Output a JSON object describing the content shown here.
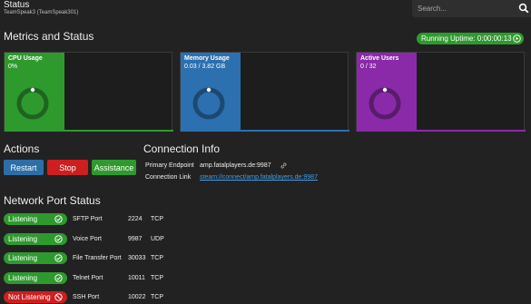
{
  "header": {
    "title": "Status",
    "subtitle": "TeamSpeak3 (TeamSpeak301)",
    "search_placeholder": "Search...",
    "search_icon": "search-icon"
  },
  "metrics": {
    "title": "Metrics and Status",
    "uptime_label": "Running Uptime: 0:00:00:13",
    "cards": [
      {
        "label": "CPU Usage",
        "value": "0%",
        "color": "#2e9a2e",
        "fraction": 0
      },
      {
        "label": "Memory Usage",
        "value": "0.03 / 3.82 GB",
        "color": "#2c70b0",
        "fraction": 0.008
      },
      {
        "label": "Active Users",
        "value": "0 / 32",
        "color": "#8a2aa8",
        "fraction": 0
      }
    ]
  },
  "actions": {
    "title": "Actions",
    "restart": "Restart",
    "stop": "Stop",
    "assistance": "Assistance",
    "colors": {
      "restart": "#2c6ea8",
      "stop": "#cc1f1f",
      "assistance": "#2e9a2e"
    }
  },
  "connection": {
    "title": "Connection Info",
    "primary_label": "Primary Endpoint",
    "primary_value": "amp.fatalplayers.de:9987",
    "link_label": "Connection Link",
    "link_value": "steam://connect/amp.fatalplayers.de:9987"
  },
  "ports": {
    "title": "Network Port Status",
    "rows": [
      {
        "status": "Listening",
        "ok": true,
        "name": "SFTP Port",
        "port": "2224",
        "protocol": "TCP"
      },
      {
        "status": "Listening",
        "ok": true,
        "name": "Voice Port",
        "port": "9987",
        "protocol": "UDP"
      },
      {
        "status": "Listening",
        "ok": true,
        "name": "File Transfer Port",
        "port": "30033",
        "protocol": "TCP"
      },
      {
        "status": "Listening",
        "ok": true,
        "name": "Telnet Port",
        "port": "10011",
        "protocol": "TCP"
      },
      {
        "status": "Not Listening",
        "ok": false,
        "name": "SSH Port",
        "port": "10022",
        "protocol": "TCP"
      }
    ],
    "colors": {
      "ok": "#2e9a2e",
      "bad": "#cc1f1f"
    }
  }
}
